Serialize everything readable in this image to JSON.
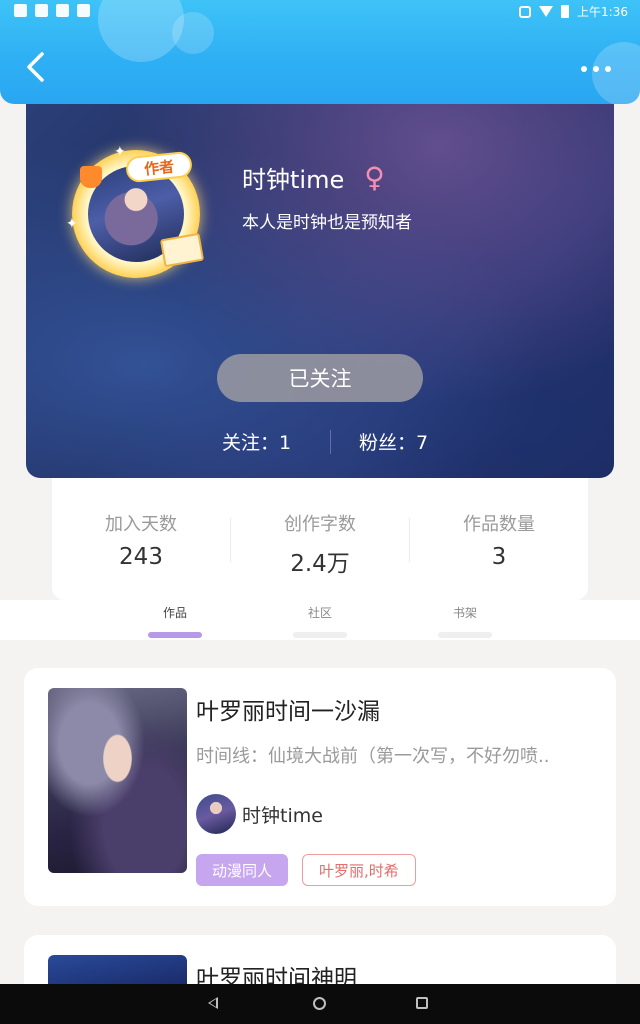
{
  "status_bar": {
    "time": "上午1:36"
  },
  "profile": {
    "badge": "作者",
    "name": "时钟time",
    "gender_symbol": "♀",
    "bio": "本人是时钟也是预知者",
    "follow_button": "已关注",
    "following": "关注：1",
    "fans": "粉丝：7"
  },
  "stats": [
    {
      "label": "加入天数",
      "value": "243"
    },
    {
      "label": "创作字数",
      "value": "2.4万"
    },
    {
      "label": "作品数量",
      "value": "3"
    }
  ],
  "tabs": [
    {
      "label": "作品",
      "active": true
    },
    {
      "label": "社区",
      "active": false
    },
    {
      "label": "书架",
      "active": false
    }
  ],
  "works": [
    {
      "title": "叶罗丽时间一沙漏",
      "description": "时间线：仙境大战前（第一次写，不好勿喷..",
      "author": "时钟time",
      "tags": [
        "动漫同人",
        "叶罗丽,时希"
      ]
    },
    {
      "title": "叶罗丽时间神明"
    }
  ],
  "colors": {
    "header": "#2fb0f4",
    "accent_purple": "#b69ae8",
    "tag_fill": "#c6a6ef",
    "tag_outline": "#e16d6d"
  },
  "icons": [
    "back-arrow-icon",
    "more-dots-icon",
    "female-gender-icon",
    "nav-back-icon",
    "nav-home-icon",
    "nav-recents-icon"
  ]
}
